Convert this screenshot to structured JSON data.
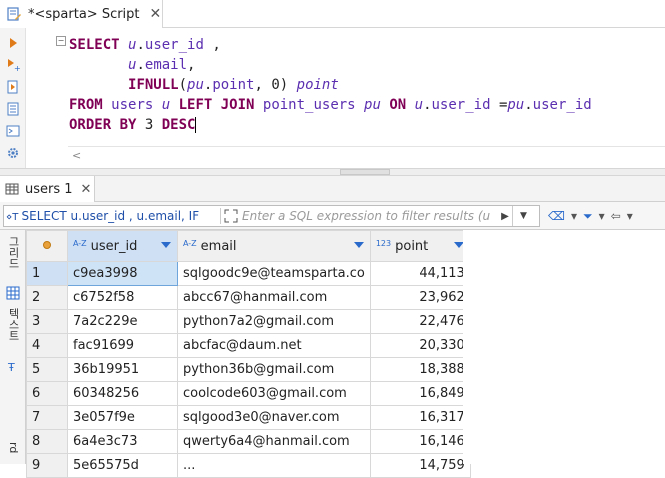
{
  "editor_tab": {
    "title": "*<sparta> Script",
    "close": "✕"
  },
  "editor": {
    "fold": "−",
    "lines": [
      [
        {
          "c": "kw",
          "t": "SELECT "
        },
        {
          "c": "al",
          "t": "u"
        },
        {
          "c": "pl",
          "t": "."
        },
        {
          "c": "id",
          "t": "user_id"
        },
        {
          "c": "pl",
          "t": " ,"
        }
      ],
      [
        {
          "c": "pl",
          "t": "       "
        },
        {
          "c": "al",
          "t": "u"
        },
        {
          "c": "pl",
          "t": "."
        },
        {
          "c": "id",
          "t": "email"
        },
        {
          "c": "pl",
          "t": ","
        }
      ],
      [
        {
          "c": "pl",
          "t": "       "
        },
        {
          "c": "kw",
          "t": "IFNULL"
        },
        {
          "c": "pl",
          "t": "("
        },
        {
          "c": "al",
          "t": "pu"
        },
        {
          "c": "pl",
          "t": "."
        },
        {
          "c": "id",
          "t": "point"
        },
        {
          "c": "pl",
          "t": ", "
        },
        {
          "c": "nm",
          "t": "0"
        },
        {
          "c": "pl",
          "t": ") "
        },
        {
          "c": "al",
          "t": "point"
        }
      ],
      [
        {
          "c": "kw",
          "t": "FROM "
        },
        {
          "c": "id",
          "t": "users "
        },
        {
          "c": "al",
          "t": "u"
        },
        {
          "c": "kw",
          "t": " LEFT JOIN "
        },
        {
          "c": "id",
          "t": "point_users "
        },
        {
          "c": "al",
          "t": "pu"
        },
        {
          "c": "kw",
          "t": " ON "
        },
        {
          "c": "al",
          "t": "u"
        },
        {
          "c": "pl",
          "t": "."
        },
        {
          "c": "id",
          "t": "user_id"
        },
        {
          "c": "pl",
          "t": " ="
        },
        {
          "c": "al",
          "t": "pu"
        },
        {
          "c": "pl",
          "t": "."
        },
        {
          "c": "id",
          "t": "user_id"
        }
      ],
      [
        {
          "c": "kw",
          "t": "ORDER BY "
        },
        {
          "c": "nm",
          "t": "3"
        },
        {
          "c": "kw",
          "t": " DESC"
        },
        {
          "c": "cursor",
          "t": ""
        }
      ]
    ],
    "scroll_left": "<"
  },
  "results_tab": {
    "label": "users 1",
    "close": "✕"
  },
  "filter": {
    "query_text": "SELECT u.user_id , u.email, IF",
    "placeholder": "Enter a SQL expression to filter results (u",
    "run_arrow": "▶",
    "dropdown": "▼"
  },
  "filter_tools": [
    {
      "icon": "eraser-icon",
      "glyph": "⌫"
    },
    {
      "icon": "dropdown-icon",
      "glyph": "▾"
    },
    {
      "icon": "filter-icon",
      "glyph": "⏷"
    },
    {
      "icon": "dropdown-icon",
      "glyph": "▾"
    },
    {
      "icon": "back-icon",
      "glyph": "⇦"
    },
    {
      "icon": "dropdown-icon",
      "glyph": "▾"
    }
  ],
  "side_tools": [
    {
      "name": "grid-view-button",
      "text": "그리드"
    },
    {
      "name": "text-view-button",
      "text": "텍스트"
    },
    {
      "name": "record-button",
      "text": "rd"
    }
  ],
  "grid": {
    "columns": [
      {
        "type": "A-Z",
        "label": "user_id"
      },
      {
        "type": "A-Z",
        "label": "email"
      },
      {
        "type": "123",
        "label": "point"
      }
    ],
    "rows": [
      {
        "n": "1",
        "user_id": "c9ea3998",
        "email": "sqlgoodc9e@teamsparta.co",
        "point": "44,113"
      },
      {
        "n": "2",
        "user_id": "c6752f58",
        "email": "abcc67@hanmail.com",
        "point": "23,962"
      },
      {
        "n": "3",
        "user_id": "7a2c229e",
        "email": "python7a2@gmail.com",
        "point": "22,476"
      },
      {
        "n": "4",
        "user_id": "fac91699",
        "email": "abcfac@daum.net",
        "point": "20,330"
      },
      {
        "n": "5",
        "user_id": "36b19951",
        "email": "python36b@gmail.com",
        "point": "18,388"
      },
      {
        "n": "6",
        "user_id": "60348256",
        "email": "coolcode603@gmail.com",
        "point": "16,849"
      },
      {
        "n": "7",
        "user_id": "3e057f9e",
        "email": "sqlgood3e0@naver.com",
        "point": "16,317"
      },
      {
        "n": "8",
        "user_id": "6a4e3c73",
        "email": "qwerty6a4@hanmail.com",
        "point": "16,146"
      },
      {
        "n": "9",
        "user_id": "5e65575d",
        "email": "...",
        "point": "14,759"
      }
    ]
  }
}
